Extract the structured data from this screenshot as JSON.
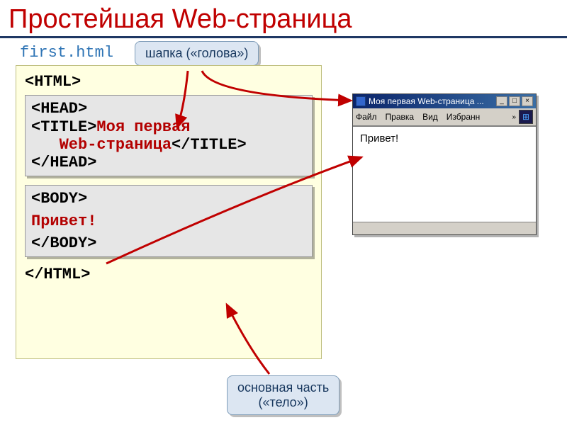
{
  "title": "Простейшая Web-страница",
  "filename": "first.html",
  "callouts": {
    "head": "шапка («голова»)",
    "body_l1": "основная часть",
    "body_l2": "(«тело»)"
  },
  "code": {
    "html_open": "<HTML>",
    "head_open": "<HEAD>",
    "title_open": "<TITLE>",
    "title_text_l1": "Моя первая",
    "title_text_l2": "Web-страница",
    "title_close": "</TITLE>",
    "head_close": "</HEAD>",
    "body_open": "<BODY>",
    "body_text": "Привет!",
    "body_close": "</BODY>",
    "html_close": "</HTML>"
  },
  "browser": {
    "title": "Моя первая Web-страница ...",
    "menu": {
      "file": "Файл",
      "edit": "Правка",
      "view": "Вид",
      "fav": "Избранн"
    },
    "content": "Привет!",
    "minimize": "_",
    "maximize": "□",
    "close": "×",
    "chevrons": "»"
  }
}
